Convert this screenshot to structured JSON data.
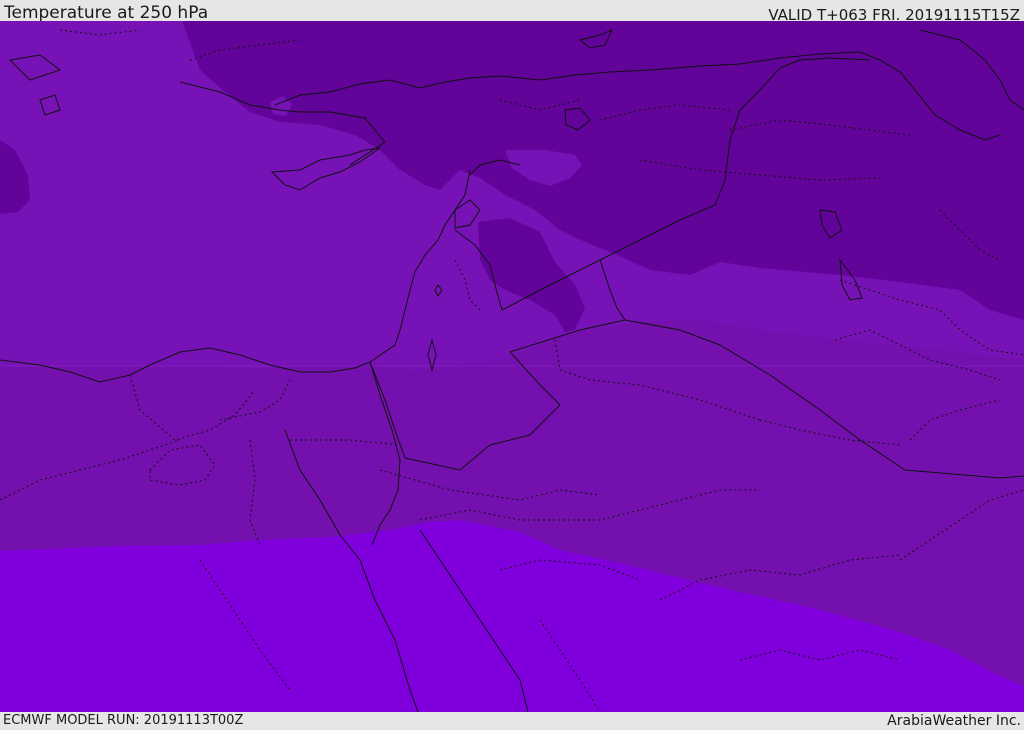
{
  "header": {
    "title": "Temperature at 250 hPa",
    "valid_time": "VALID T+063 FRI. 20191115T15Z"
  },
  "footer": {
    "model_run": "ECMWF MODEL RUN: 20191113T00Z",
    "credit": "ArabiaWeather Inc."
  },
  "map": {
    "field": "Temperature at 250 hPa",
    "colors": {
      "coldest_band": "#62049a",
      "middle_band": "#7713b6",
      "lower_middle_band": "#7410ad",
      "warmest_band": "#7f00dc",
      "border_line": "#111111"
    }
  }
}
